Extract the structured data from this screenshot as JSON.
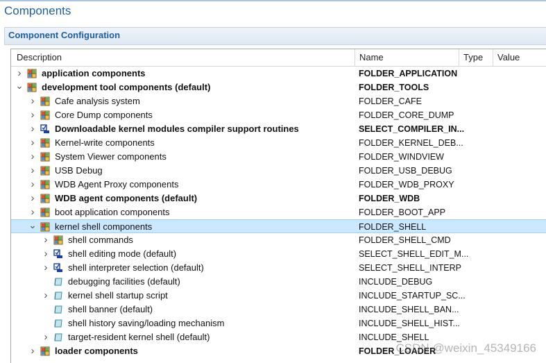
{
  "page": {
    "title": "Components",
    "section_title": "Component Configuration"
  },
  "columns": {
    "description": "Description",
    "name": "Name",
    "type": "Type",
    "value": "Value"
  },
  "rows": [
    {
      "label": "application components",
      "name": "FOLDER_APPLICATION",
      "bold": true,
      "level": 0,
      "expander": "collapsed",
      "icon": "folder-icon"
    },
    {
      "label": "development tool components (default)",
      "name": "FOLDER_TOOLS",
      "bold": true,
      "level": 0,
      "expander": "expanded",
      "icon": "folder-icon"
    },
    {
      "label": "Cafe analysis system",
      "name": "FOLDER_CAFE",
      "bold": false,
      "level": 1,
      "expander": "collapsed",
      "icon": "folder-icon"
    },
    {
      "label": "Core Dump components",
      "name": "FOLDER_CORE_DUMP",
      "bold": false,
      "level": 1,
      "expander": "collapsed",
      "icon": "folder-icon"
    },
    {
      "label": "Downloadable kernel modules compiler support routines",
      "name": "SELECT_COMPILER_IN...",
      "bold": true,
      "level": 1,
      "expander": "collapsed",
      "icon": "selection-icon"
    },
    {
      "label": "Kernel-write components",
      "name": "FOLDER_KERNEL_DEB...",
      "bold": false,
      "level": 1,
      "expander": "collapsed",
      "icon": "folder-icon"
    },
    {
      "label": "System Viewer components",
      "name": "FOLDER_WINDVIEW",
      "bold": false,
      "level": 1,
      "expander": "collapsed",
      "icon": "folder-icon"
    },
    {
      "label": "USB Debug",
      "name": "FOLDER_USB_DEBUG",
      "bold": false,
      "level": 1,
      "expander": "collapsed",
      "icon": "folder-icon"
    },
    {
      "label": "WDB Agent Proxy components",
      "name": "FOLDER_WDB_PROXY",
      "bold": false,
      "level": 1,
      "expander": "collapsed",
      "icon": "folder-icon"
    },
    {
      "label": "WDB agent components (default)",
      "name": "FOLDER_WDB",
      "bold": true,
      "level": 1,
      "expander": "collapsed",
      "icon": "folder-icon"
    },
    {
      "label": "boot application components",
      "name": "FOLDER_BOOT_APP",
      "bold": false,
      "level": 1,
      "expander": "collapsed",
      "icon": "folder-icon"
    },
    {
      "label": "kernel shell components",
      "name": "FOLDER_SHELL",
      "bold": false,
      "level": 1,
      "expander": "expanded",
      "icon": "folder-icon",
      "selected": true
    },
    {
      "label": "shell commands",
      "name": "FOLDER_SHELL_CMD",
      "bold": false,
      "level": 2,
      "expander": "collapsed",
      "icon": "folder-icon"
    },
    {
      "label": "shell editing mode (default)",
      "name": "SELECT_SHELL_EDIT_M...",
      "bold": false,
      "level": 2,
      "expander": "collapsed",
      "icon": "selection-icon"
    },
    {
      "label": "shell interpreter selection (default)",
      "name": "SELECT_SHELL_INTERP",
      "bold": false,
      "level": 2,
      "expander": "collapsed",
      "icon": "selection-icon"
    },
    {
      "label": "debugging facilities (default)",
      "name": "INCLUDE_DEBUG",
      "bold": false,
      "level": 2,
      "expander": "none",
      "icon": "component-icon"
    },
    {
      "label": "kernel shell startup script",
      "name": "INCLUDE_STARTUP_SC...",
      "bold": false,
      "level": 2,
      "expander": "collapsed",
      "icon": "component-icon"
    },
    {
      "label": "shell banner (default)",
      "name": "INCLUDE_SHELL_BAN...",
      "bold": false,
      "level": 2,
      "expander": "none",
      "icon": "component-icon"
    },
    {
      "label": "shell history saving/loading mechanism",
      "name": "INCLUDE_SHELL_HIST...",
      "bold": false,
      "level": 2,
      "expander": "none",
      "icon": "component-icon"
    },
    {
      "label": "target-resident kernel shell (default)",
      "name": "INCLUDE_SHELL",
      "bold": false,
      "level": 2,
      "expander": "collapsed",
      "icon": "component-icon"
    },
    {
      "label": "loader components",
      "name": "FOLDER_LOADER",
      "bold": true,
      "level": 1,
      "expander": "collapsed",
      "icon": "folder-icon"
    }
  ],
  "watermark": "CSDN @weixin_45349166"
}
